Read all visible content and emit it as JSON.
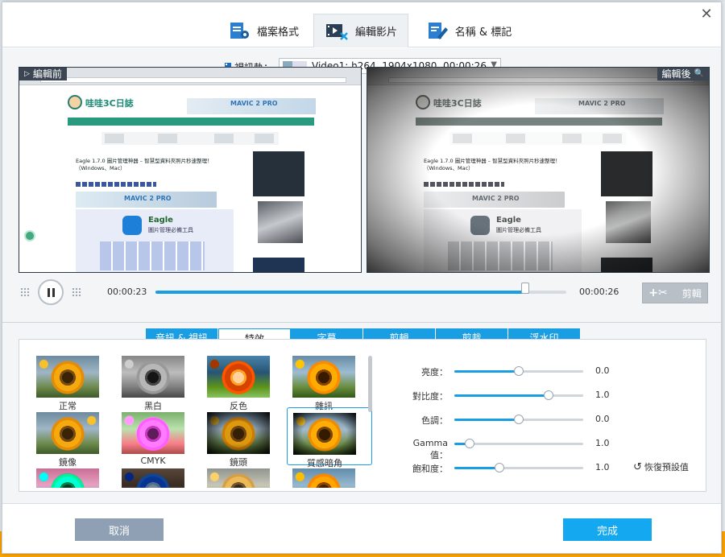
{
  "top_tabs": [
    {
      "label": "檔案格式",
      "icon": "file-format-icon"
    },
    {
      "label": "編輯影片",
      "icon": "edit-video-icon"
    },
    {
      "label": "名稱 & 標記",
      "icon": "rename-tag-icon"
    }
  ],
  "track": {
    "label": "視訊軌：",
    "selected": "Video1: h264, 1904x1080, 00:00:26"
  },
  "preview": {
    "before_label": "編輯前",
    "after_label": "編輯後",
    "site_title": "哇哇3C日誌",
    "ad_text": "MAVIC 2 PRO",
    "article_title": "Eagle 1.7.0 圖片管理神器 – 智慧型資料夾照片秒速整理！（Windows、Mac）",
    "eagle_title": "Eagle",
    "eagle_subtitle": "圖片管理必備工具"
  },
  "player": {
    "current_time": "00:00:23",
    "total_time": "00:00:26",
    "progress": 0.9,
    "cut_label": "剪輯"
  },
  "sub_tabs": [
    "音訊 & 視訊",
    "特效",
    "字幕",
    "剪輯",
    "剪裁",
    "浮水印"
  ],
  "active_sub_tab": 1,
  "effects": [
    {
      "label": "正常"
    },
    {
      "label": "黑白"
    },
    {
      "label": "反色"
    },
    {
      "label": "雜訊"
    },
    {
      "label": "鏡像"
    },
    {
      "label": "CMYK"
    },
    {
      "label": "鏡頭"
    },
    {
      "label": "質感暗角"
    }
  ],
  "active_effect": 7,
  "adjustments": [
    {
      "label": "亮度：",
      "value": "0.0",
      "level": 0.5
    },
    {
      "label": "對比度：",
      "value": "1.0",
      "level": 0.73
    },
    {
      "label": "色調：",
      "value": "0.0",
      "level": 0.5
    },
    {
      "label": "Gamma值：",
      "value": "1.0",
      "level": 0.12
    },
    {
      "label": "飽和度：",
      "value": "1.0",
      "level": 0.35
    }
  ],
  "reset_label": "恢復預設值",
  "buttons": {
    "cancel": "取消",
    "done": "完成"
  },
  "colors": {
    "accent": "#1a9ee3",
    "done": "#14a8f0",
    "cancel": "#8fa0b4"
  }
}
